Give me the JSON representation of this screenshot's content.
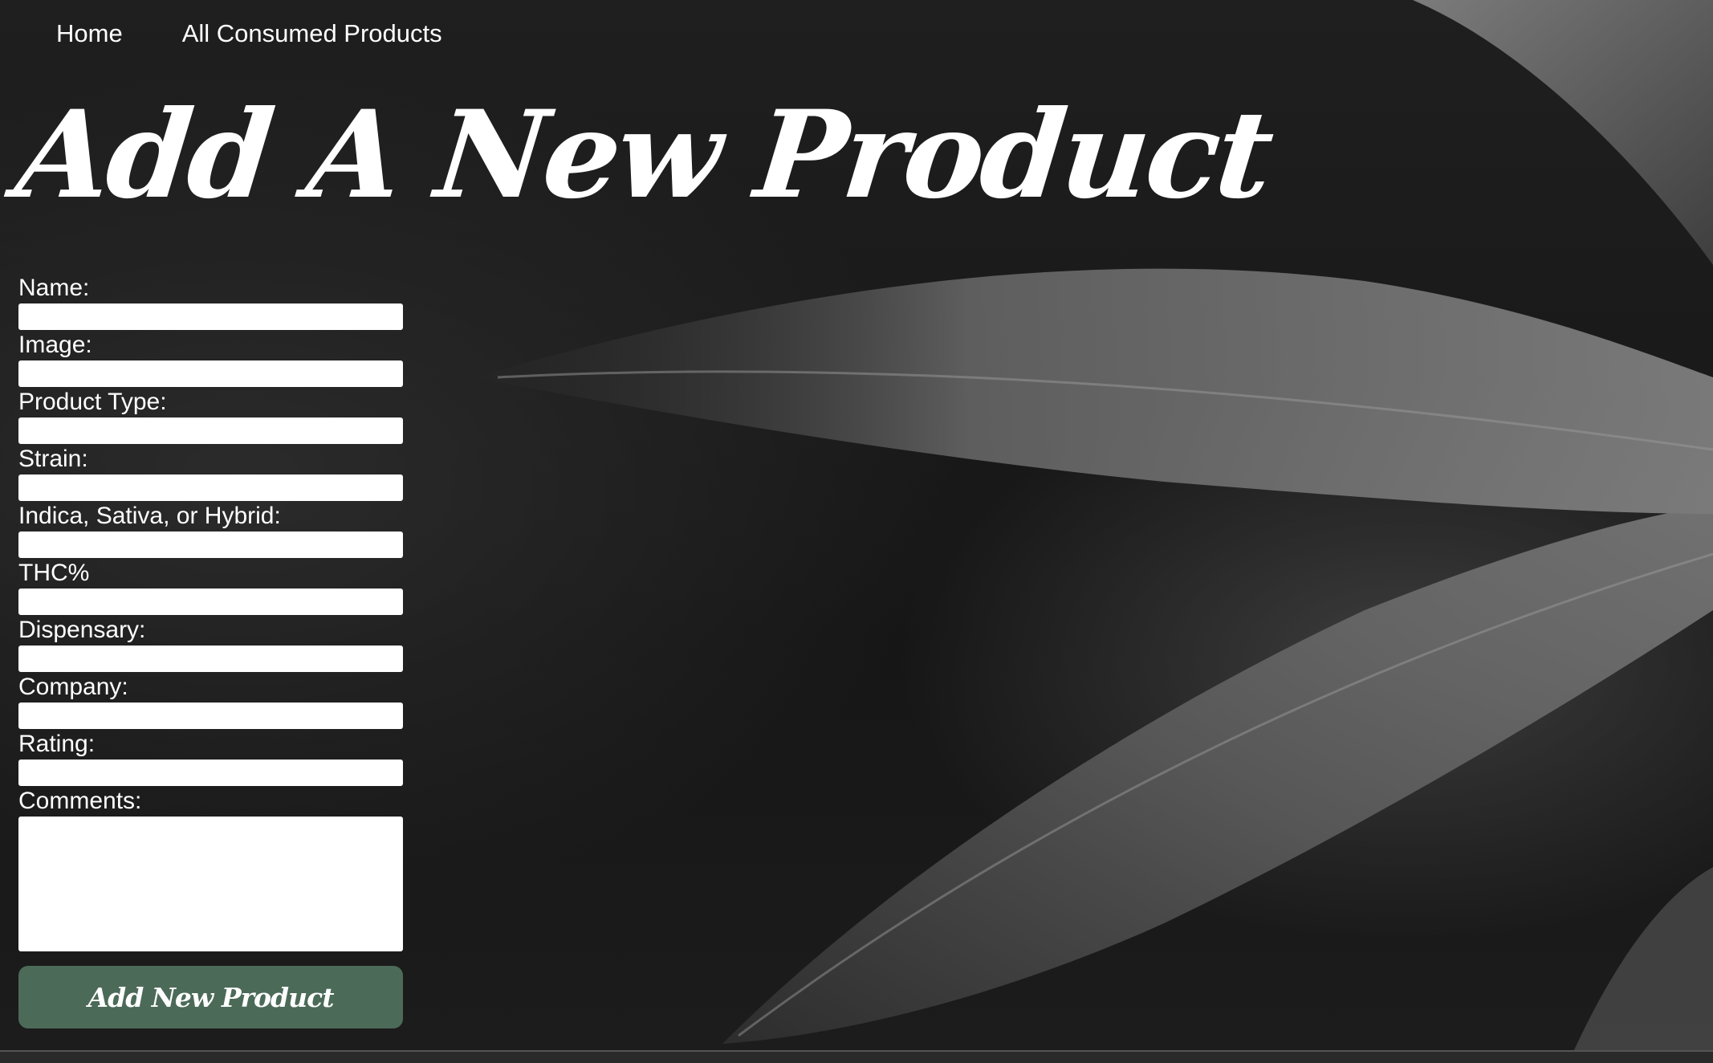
{
  "nav": {
    "items": [
      {
        "label": "Home"
      },
      {
        "label": "All Consumed Products"
      }
    ]
  },
  "page_title": "Add A New Product",
  "form": {
    "fields": [
      {
        "label": "Name:",
        "value": ""
      },
      {
        "label": "Image:",
        "value": ""
      },
      {
        "label": "Product Type:",
        "value": ""
      },
      {
        "label": "Strain:",
        "value": ""
      },
      {
        "label": "Indica, Sativa, or Hybrid:",
        "value": ""
      },
      {
        "label": "THC%",
        "value": ""
      },
      {
        "label": "Dispensary:",
        "value": ""
      },
      {
        "label": "Company:",
        "value": ""
      },
      {
        "label": "Rating:",
        "value": ""
      },
      {
        "label": "Comments:",
        "value": ""
      }
    ],
    "submit_label": "Add New Product"
  },
  "colors": {
    "submit_button": "#4c6a58",
    "background": "#1a1a1a"
  }
}
